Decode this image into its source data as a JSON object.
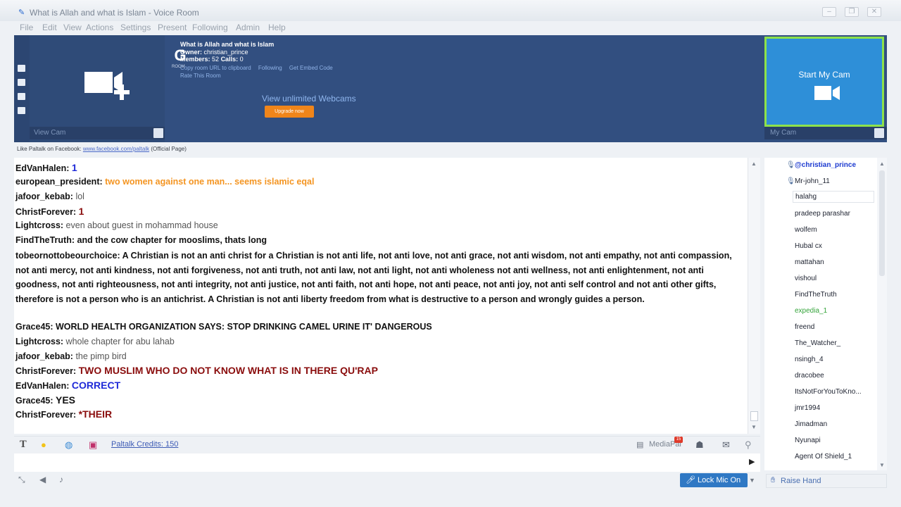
{
  "window": {
    "title": "What is Allah and what is Islam - Voice Room",
    "min": "–",
    "max": "❐",
    "close": "✕"
  },
  "menu": {
    "file": "File",
    "edit": "Edit",
    "view": "View",
    "actions": "Actions",
    "settings": "Settings",
    "present": "Present",
    "following": "Following",
    "admin": "Admin",
    "help": "Help"
  },
  "header": {
    "view_cam": "View Cam",
    "g_logo": "G",
    "g_sub": "ROOM",
    "room_title": "What is Allah and what is Islam",
    "owner_label": "Owner:",
    "owner": "christian_prince",
    "members_label": "Members:",
    "members": "52",
    "calls_label": "Calls:",
    "calls": "0",
    "copy_url": "Copy room URL to clipboard",
    "following": "Following",
    "embed": "Get Embed Code",
    "rate": "Rate This Room",
    "unlimited": "View unlimited Webcams",
    "upgrade": "Upgrade now",
    "start_cam": "Start My Cam",
    "my_cam": "My Cam"
  },
  "facebook": {
    "prefix": "Like Paltalk on Facebook:",
    "link": "www.facebook.com/paltalk",
    "suffix": "(Official Page)"
  },
  "chat": {
    "messages": [
      {
        "nick": "EdVanHalen:",
        "text": "1"
      },
      {
        "nick": "european_president:",
        "text": "two women against one man... seems islamic eqal"
      },
      {
        "nick": "jafoor_kebab:",
        "text": "lol"
      },
      {
        "nick": "ChristForever:",
        "text": "1"
      },
      {
        "nick": "Lightcross:",
        "text": "even about guest in mohammad house"
      },
      {
        "nick": "FindTheTruth:",
        "text": "and the cow chapter for mooslims, thats long"
      },
      {
        "nick": "tobeornottobeourchoice:",
        "text": "A Christian is not an anti christ for a Christian is not anti life, not anti love, not anti grace, not anti wisdom, not anti empathy, not anti compassion, not anti mercy, not anti kindness, not anti forgiveness, not anti truth, not anti law, not anti light, not anti wholeness not anti wellness, not anti enlightenment, not anti goodness, not anti righteousness, not anti integrity,  not anti justice, not anti faith, not anti hope, not anti peace, not anti joy, not anti self control and not anti other gifts, therefore is not a person who is an antichrist. A Christian is not anti liberty freedom from what is destructive to a person and wrongly guides a person."
      },
      {
        "nick": "Grace45:",
        "text": "WORLD HEALTH ORGANIZATION SAYS: STOP DRINKING CAMEL URINE IT' DANGEROUS"
      },
      {
        "nick": "Lightcross:",
        "text": "whole chapter for abu lahab"
      },
      {
        "nick": "jafoor_kebab:",
        "text": "the pimp bird"
      },
      {
        "nick": "ChristForever:",
        "text": "TWO MUSLIM WHO DO NOT KNOW WHAT IS IN THERE QU'RAP"
      },
      {
        "nick": "EdVanHalen:",
        "text": "CORRECT"
      },
      {
        "nick": "Grace45:",
        "text": "YES"
      },
      {
        "nick": "ChristForever:",
        "text": "*THEIR"
      }
    ]
  },
  "toolbar": {
    "text_icon": "T",
    "credits": "Paltalk Credits: 150",
    "mediapal": "MediaPal",
    "badge": "15"
  },
  "lock_mic": "Lock Mic On",
  "raise_hand": "Raise Hand",
  "users": [
    "@christian_prince",
    "Mr-john_11",
    "halahg",
    "pradeep parashar",
    "wolfem",
    "Hubal cx",
    "mattahan",
    "vishoul",
    "FindTheTruth",
    "expedia_1",
    "freend",
    "The_Watcher_",
    "nsingh_4",
    "dracobee",
    "ItsNotForYouToKno...",
    "jmr1994",
    "Jimadman",
    "Nyunapi",
    "Agent Of Shield_1"
  ],
  "colors": {
    "header_bg": "#324f80",
    "mycam_bg": "#2e8fd8",
    "mycam_border": "#8ee24a",
    "upgrade": "#f0851a",
    "owner_blue": "#1c3ad0",
    "chat_red": "#8a0d0d",
    "chat_blue": "#1f2ad8",
    "chat_orange": "#f49522"
  }
}
